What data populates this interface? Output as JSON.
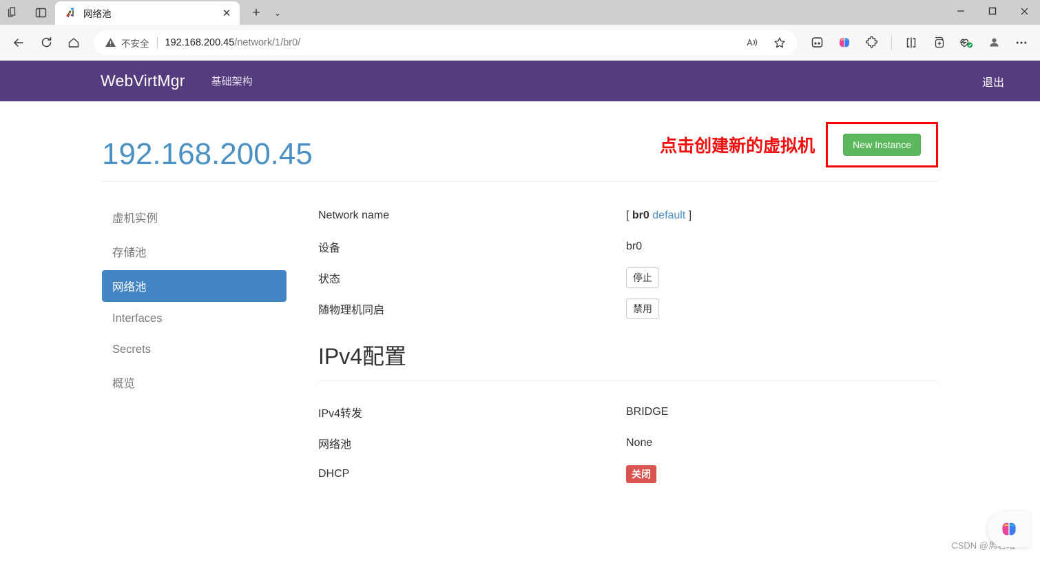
{
  "browser": {
    "window_icons": [
      {
        "name": "copilot-sidebar-icon",
        "glyph": "copilot-stack"
      },
      {
        "name": "tab-actions-icon",
        "glyph": "panel"
      }
    ],
    "tab": {
      "favicon_name": "webvirtmgr-favicon",
      "title": "网络池",
      "close_label": "✕"
    },
    "new_tab_label": "+",
    "tab_dropdown_label": "⌄",
    "window_controls": {
      "minimize": "—",
      "maximize": "▢",
      "close": "✕"
    },
    "toolbar": {
      "back_label": "←",
      "refresh_label": "⟳",
      "home_label": "⌂",
      "security_warning": "不安全",
      "url_host": "192.168.200.45",
      "url_path": "/network/1/br0/",
      "read_aloud_label": "A",
      "favorite_label": "☆",
      "right_icons": [
        {
          "name": "collections-icon"
        },
        {
          "name": "copilot-icon"
        },
        {
          "name": "extensions-icon"
        },
        {
          "name": "split-screen-icon"
        },
        {
          "name": "add-to-collection-icon"
        },
        {
          "name": "browser-essentials-icon"
        },
        {
          "name": "profile-icon"
        },
        {
          "name": "settings-more-icon"
        }
      ]
    }
  },
  "app": {
    "brand": "WebVirtMgr",
    "nav_link": "基础架构",
    "logout": "退出",
    "page_title": "192.168.200.45",
    "annotation": "点击创建新的虚拟机",
    "new_instance_button": "New Instance",
    "sidebar": {
      "items": [
        {
          "label": "虚机实例",
          "active": false
        },
        {
          "label": "存储池",
          "active": false
        },
        {
          "label": "网络池",
          "active": true
        },
        {
          "label": "Interfaces",
          "active": false
        },
        {
          "label": "Secrets",
          "active": false
        },
        {
          "label": "概览",
          "active": false
        }
      ]
    },
    "details": {
      "network_name_label": "Network name",
      "network_name_bracket_open": "[",
      "network_name_value": "br0",
      "network_name_link": "default",
      "network_name_bracket_close": "]",
      "device_label": "设备",
      "device_value": "br0",
      "status_label": "状态",
      "status_value": "停止",
      "autostart_label": "随物理机同启",
      "autostart_value": "禁用"
    },
    "ipv4": {
      "heading": "IPv4配置",
      "forward_label": "IPv4转发",
      "forward_value": "BRIDGE",
      "pool_label": "网络池",
      "pool_value": "None",
      "dhcp_label": "DHCP",
      "dhcp_value": "关闭"
    },
    "watermark": "CSDN @馬若曦"
  },
  "colors": {
    "navbar_purple": "#543c7e",
    "title_blue": "#4a90c4",
    "active_blue": "#4285c4",
    "green": "#5cb85c",
    "red_annotation": "#f20d0d",
    "badge_red": "#d9534f"
  }
}
